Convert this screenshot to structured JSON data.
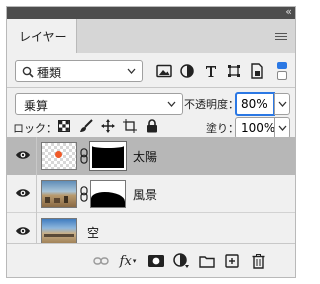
{
  "panel": {
    "tab_label": "レイヤー",
    "collapse_glyph": "«",
    "close_glyph": "×"
  },
  "filter": {
    "kind_label": "種類",
    "icons": [
      "image-filter-icon",
      "adjustment-filter-icon",
      "type-filter-icon",
      "shape-filter-icon",
      "smartobject-filter-icon"
    ]
  },
  "blend": {
    "mode": "乗算",
    "opacity_label": "不透明度：",
    "opacity_value": "80%"
  },
  "lock": {
    "label": "ロック：",
    "fill_label": "塗り：",
    "fill_value": "100%"
  },
  "layers": [
    {
      "name": "太陽",
      "selected": true
    },
    {
      "name": "風景",
      "selected": false
    },
    {
      "name": "空",
      "selected": false
    }
  ],
  "footer": {
    "fx_label": "fx"
  },
  "colors": {
    "selected_row": "#b7b7b7",
    "accent_blue": "#2b78e4",
    "sun_orange": "#f05a28"
  }
}
